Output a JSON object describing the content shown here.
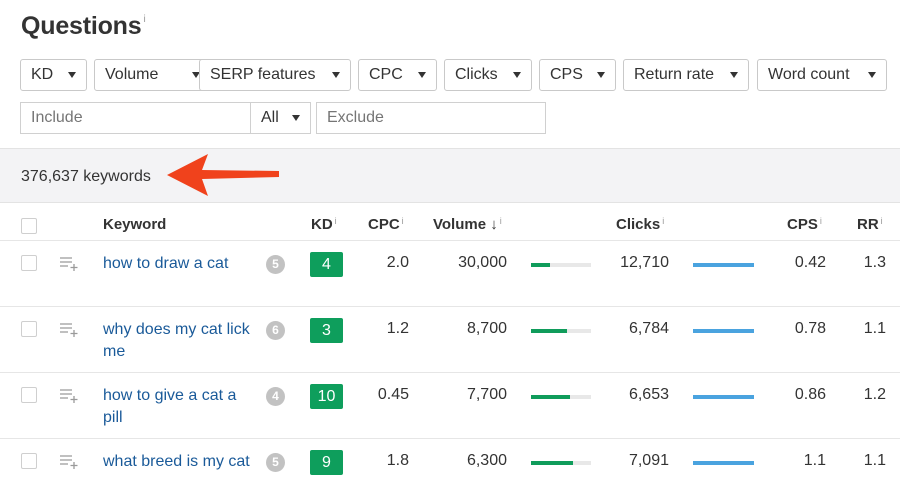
{
  "page": {
    "title": "Questions",
    "info": "i"
  },
  "filters": [
    {
      "label": "KD"
    },
    {
      "label": "Volume"
    },
    {
      "label": "SERP features"
    },
    {
      "label": "CPC"
    },
    {
      "label": "Clicks"
    },
    {
      "label": "CPS"
    },
    {
      "label": "Return rate"
    },
    {
      "label": "Word count"
    }
  ],
  "search": {
    "include_placeholder": "Include",
    "match_select": "All",
    "exclude_placeholder": "Exclude"
  },
  "summary": {
    "count_text": "376,637 keywords"
  },
  "table": {
    "headers": {
      "keyword": "Keyword",
      "kd": "KD",
      "cpc": "CPC",
      "volume": "Volume",
      "sort_arrow": "↓",
      "clicks": "Clicks",
      "cps": "CPS",
      "rr": "RR",
      "info": "i"
    },
    "rows": [
      {
        "keyword": "how to draw a cat",
        "serp": "5",
        "kd": "4",
        "cpc": "2.0",
        "volume": "30,000",
        "volume_fraction": 0.32,
        "clicks": "12,710",
        "cps": "0.42",
        "rr": "1.3"
      },
      {
        "keyword": "why does my cat lick me",
        "serp": "6",
        "kd": "3",
        "cpc": "1.2",
        "volume": "8,700",
        "volume_fraction": 0.6,
        "clicks": "6,784",
        "cps": "0.78",
        "rr": "1.1"
      },
      {
        "keyword": "how to give a cat a pill",
        "serp": "4",
        "kd": "10",
        "cpc": "0.45",
        "volume": "7,700",
        "volume_fraction": 0.65,
        "clicks": "6,653",
        "cps": "0.86",
        "rr": "1.2"
      },
      {
        "keyword": "what breed is my cat",
        "serp": "5",
        "kd": "9",
        "cpc": "1.8",
        "volume": "6,300",
        "volume_fraction": 0.7,
        "clicks": "7,091",
        "cps": "1.1",
        "rr": "1.1"
      }
    ]
  },
  "colors": {
    "kd_badge": "#0e9e5c",
    "volume_bar": "#109c5b",
    "clicks_bar": "#4aa3df",
    "keyword_link": "#1a5a99",
    "arrow": "#f0421c"
  }
}
